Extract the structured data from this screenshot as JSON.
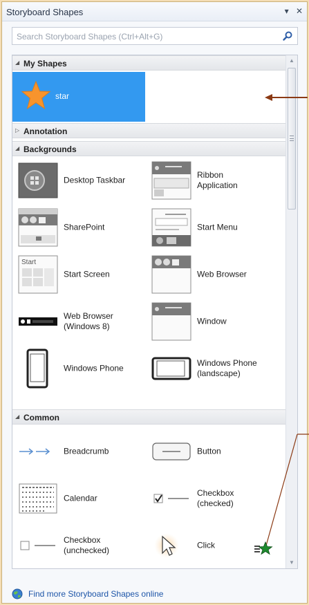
{
  "window": {
    "title": "Storyboard Shapes",
    "dropdown_glyph": "▾",
    "close_glyph": "✕"
  },
  "search": {
    "placeholder": "Search Storyboard Shapes (Ctrl+Alt+G)",
    "value": ""
  },
  "sections": {
    "my_shapes": {
      "label": "My Shapes",
      "expanded": true,
      "items": [
        {
          "label": "star",
          "selected": true
        }
      ]
    },
    "annotation": {
      "label": "Annotation",
      "expanded": false
    },
    "backgrounds": {
      "label": "Backgrounds",
      "expanded": true,
      "items": [
        {
          "label": "Desktop Taskbar"
        },
        {
          "label": "Ribbon\nApplication"
        },
        {
          "label": "SharePoint"
        },
        {
          "label": "Start Menu"
        },
        {
          "label": "Start Screen"
        },
        {
          "label": "Web Browser"
        },
        {
          "label": "Web Browser\n(Windows 8)"
        },
        {
          "label": "Window"
        },
        {
          "label": "Windows Phone"
        },
        {
          "label": "Windows Phone\n(landscape)"
        }
      ],
      "start_thumb_text": "Start"
    },
    "common": {
      "label": "Common",
      "expanded": true,
      "items": [
        {
          "label": "Breadcrumb"
        },
        {
          "label": "Button"
        },
        {
          "label": "Calendar"
        },
        {
          "label": "Checkbox\n(checked)"
        },
        {
          "label": "Checkbox\n(unchecked)"
        },
        {
          "label": "Click"
        }
      ]
    }
  },
  "footer": {
    "link_label": "Find more Storyboard Shapes online"
  },
  "icons": {
    "search": "magnifier-icon",
    "footer": "globe-icon",
    "cursor": "pointer-cursor-icon",
    "star": "star-icon"
  },
  "colors": {
    "selection": "#3399f0",
    "star_fill": "#f7942d",
    "annotation_arrow": "#8b3a14",
    "link": "#1d55a8",
    "background": "#f4ddb4"
  }
}
